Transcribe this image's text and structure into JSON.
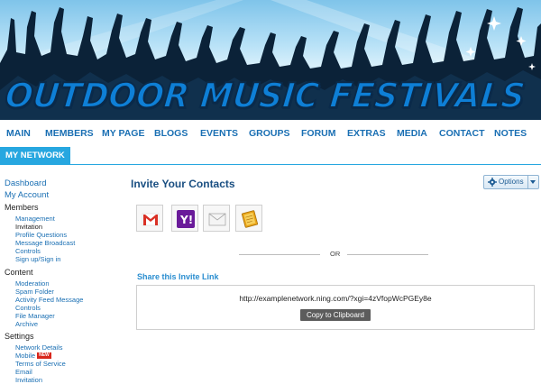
{
  "banner": {
    "title": "OUTDOOR MUSIC FESTIVALS"
  },
  "nav": {
    "items": [
      "MAIN",
      "MEMBERS",
      "MY PAGE",
      "BLOGS",
      "EVENTS",
      "GROUPS",
      "FORUM",
      "EXTRAS",
      "MEDIA",
      "CONTACT",
      "NOTES"
    ],
    "tab": "MY NETWORK"
  },
  "sidebar": {
    "dashboard": "Dashboard",
    "my_account": "My Account",
    "members": {
      "title": "Members",
      "items": [
        "Management",
        "Invitation",
        "Profile Questions",
        "Message Broadcast",
        "Controls",
        "Sign up/Sign in"
      ]
    },
    "content": {
      "title": "Content",
      "items": [
        "Moderation",
        "Spam Folder",
        "Activity Feed Message",
        "Controls",
        "File Manager",
        "Archive"
      ]
    },
    "settings": {
      "title": "Settings",
      "items": [
        "Network Details",
        "Mobile",
        "Terms of Service",
        "Email",
        "Invitation"
      ],
      "new_badge": "NEW"
    }
  },
  "main": {
    "title": "Invite Your Contacts",
    "options_label": "Options",
    "services": [
      "gmail-icon",
      "yahoo-icon",
      "email-icon",
      "address-book-icon"
    ],
    "or_text": "OR",
    "share_title": "Share this Invite Link",
    "invite_url": "http://examplenetwork.ning.com/?xgi=4zVfopWcPGEy8e",
    "copy_label": "Copy to Clipboard"
  },
  "colors": {
    "link": "#1a6fb3",
    "accent": "#27a7e0",
    "title": "#1a4f82"
  }
}
